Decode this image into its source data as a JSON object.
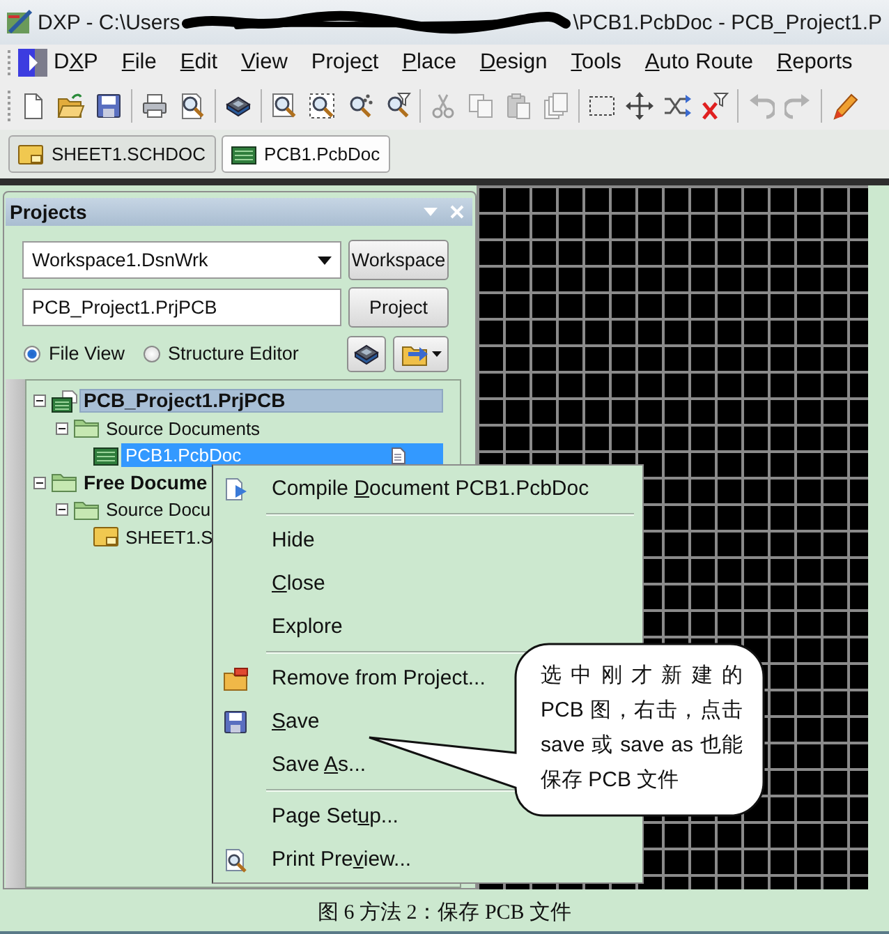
{
  "window": {
    "title_start": "DXP - C:\\Users",
    "title_end": "\\PCB1.PcbDoc - PCB_Project1.P"
  },
  "menu_bar": [
    {
      "pre": "D",
      "key": "X",
      "post": "P"
    },
    {
      "key": "F",
      "post": "ile"
    },
    {
      "key": "E",
      "post": "dit"
    },
    {
      "key": "V",
      "post": "iew"
    },
    {
      "pre": "Proje",
      "key": "c",
      "post": "t"
    },
    {
      "key": "P",
      "post": "lace"
    },
    {
      "key": "D",
      "post": "esign"
    },
    {
      "key": "T",
      "post": "ools"
    },
    {
      "key": "A",
      "post": "uto Route"
    },
    {
      "key": "R",
      "post": "eports"
    }
  ],
  "toolbar_groups": [
    [
      {
        "kind": "new",
        "disabled": false
      },
      {
        "kind": "open",
        "disabled": false
      },
      {
        "kind": "save",
        "disabled": false
      }
    ],
    [
      {
        "kind": "print",
        "disabled": false
      },
      {
        "kind": "preview",
        "disabled": false
      }
    ],
    [
      {
        "kind": "layers",
        "disabled": false
      }
    ],
    [
      {
        "kind": "zoom-page",
        "disabled": false
      },
      {
        "kind": "zoom-area",
        "disabled": false
      },
      {
        "kind": "zoom-dots",
        "disabled": false
      },
      {
        "kind": "zoom-filter",
        "disabled": false
      }
    ],
    [
      {
        "kind": "cut",
        "disabled": true
      },
      {
        "kind": "copy",
        "disabled": true
      },
      {
        "kind": "paste",
        "disabled": true
      },
      {
        "kind": "paste-special",
        "disabled": true
      }
    ],
    [
      {
        "kind": "select-area",
        "disabled": false
      },
      {
        "kind": "move",
        "disabled": false
      },
      {
        "kind": "cross-select",
        "disabled": false
      },
      {
        "kind": "clear-filter",
        "disabled": false
      }
    ],
    [
      {
        "kind": "undo",
        "disabled": true
      },
      {
        "kind": "redo",
        "disabled": true
      }
    ],
    [
      {
        "kind": "highlight",
        "disabled": false
      }
    ]
  ],
  "document_tabs": [
    {
      "label": "SHEET1.SCHDOC",
      "kind": "schematic",
      "selected": false
    },
    {
      "label": "PCB1.PcbDoc",
      "kind": "pcb",
      "selected": true
    }
  ],
  "projects_panel": {
    "title": "Projects",
    "workspace_dropdown": {
      "value": "Workspace1.DsnWrk"
    },
    "workspace_button": "Workspace",
    "project_field": {
      "value": "PCB_Project1.PrjPCB"
    },
    "project_button": "Project",
    "view_options": [
      {
        "label": "File View",
        "selected": true
      },
      {
        "label": "Structure Editor",
        "selected": false
      }
    ],
    "tree": [
      {
        "label": "PCB_Project1.PrjPCB",
        "kind": "project",
        "expanded": true,
        "selected": false,
        "active": true,
        "open": false,
        "children": [
          {
            "label": "Source Documents",
            "kind": "folder",
            "expanded": true,
            "selected": false,
            "active": false,
            "open": false,
            "children": [
              {
                "label": "PCB1.PcbDoc",
                "kind": "pcb",
                "selected": true,
                "active": false,
                "open": true
              }
            ]
          }
        ]
      },
      {
        "label": "Free Docume",
        "kind": "group",
        "expanded": true,
        "selected": false,
        "active": false,
        "open": false,
        "children": [
          {
            "label": "Source Docu",
            "kind": "folder",
            "expanded": true,
            "selected": false,
            "active": false,
            "open": false,
            "children": [
              {
                "label": "SHEET1.S",
                "kind": "schematic",
                "selected": false,
                "active": false,
                "open": false
              }
            ]
          }
        ]
      }
    ]
  },
  "context_menu": [
    {
      "kind": "compile",
      "pre": "Compile ",
      "key": "D",
      "post": "ocument PCB1.PcbDoc"
    },
    {
      "kind": "separator"
    },
    {
      "kind": "plain",
      "pre": "Hide"
    },
    {
      "kind": "plain",
      "key": "C",
      "post": "lose"
    },
    {
      "kind": "plain",
      "pre": "Explore"
    },
    {
      "kind": "separator"
    },
    {
      "kind": "remove",
      "pre": "Remove from Project..."
    },
    {
      "kind": "save",
      "key": "S",
      "post": "ave"
    },
    {
      "kind": "plain",
      "pre": "Save ",
      "key": "A",
      "post": "s..."
    },
    {
      "kind": "separator"
    },
    {
      "kind": "plain",
      "pre": "Page Set",
      "key": "u",
      "post": "p..."
    },
    {
      "kind": "preview",
      "pre": "Print Pre",
      "key": "v",
      "post": "iew..."
    }
  ],
  "callout": {
    "lines": [
      "选中刚才新建的",
      "PCB 图，右击，点击",
      "save 或 save as 也能",
      "保存 PCB 文件"
    ]
  },
  "caption": "图 6 方法 2：保存 PCB 文件"
}
